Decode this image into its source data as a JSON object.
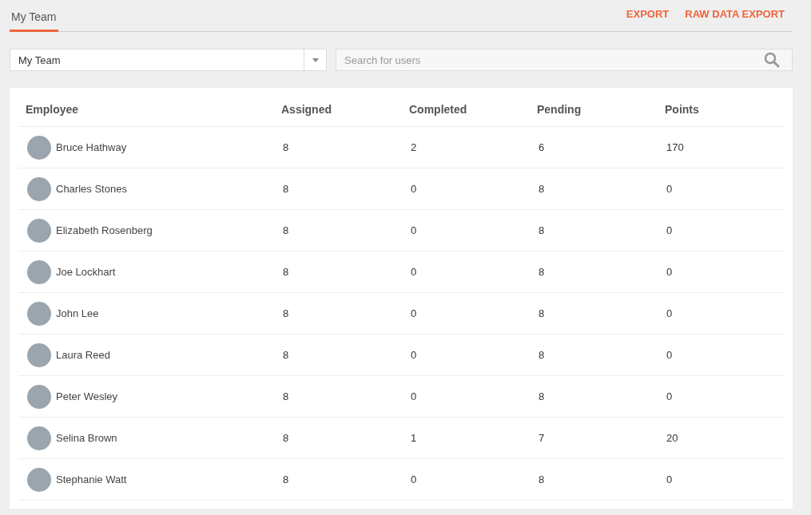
{
  "tabs": [
    {
      "label": "My Team",
      "selected": true
    }
  ],
  "actions": [
    "EXPORT",
    "RAW DATA EXPORT"
  ],
  "team_select": {
    "value": "My Team"
  },
  "search": {
    "placeholder": "Search for users"
  },
  "table": {
    "columns": [
      "Employee",
      "Assigned",
      "Completed",
      "Pending",
      "Points"
    ],
    "rows": [
      {
        "name": "Bruce Hathway",
        "assigned": "8",
        "completed": "2",
        "pending": "6",
        "points": "170"
      },
      {
        "name": "Charles Stones",
        "assigned": "8",
        "completed": "0",
        "pending": "8",
        "points": "0"
      },
      {
        "name": "Elizabeth Rosenberg",
        "assigned": "8",
        "completed": "0",
        "pending": "8",
        "points": "0"
      },
      {
        "name": "Joe Lockhart",
        "assigned": "8",
        "completed": "0",
        "pending": "8",
        "points": "0"
      },
      {
        "name": "John Lee",
        "assigned": "8",
        "completed": "0",
        "pending": "8",
        "points": "0"
      },
      {
        "name": "Laura Reed",
        "assigned": "8",
        "completed": "0",
        "pending": "8",
        "points": "0"
      },
      {
        "name": "Peter Wesley",
        "assigned": "8",
        "completed": "0",
        "pending": "8",
        "points": "0"
      },
      {
        "name": "Selina Brown",
        "assigned": "8",
        "completed": "1",
        "pending": "7",
        "points": "20"
      },
      {
        "name": "Stephanie Watt",
        "assigned": "8",
        "completed": "0",
        "pending": "8",
        "points": "0"
      }
    ]
  }
}
